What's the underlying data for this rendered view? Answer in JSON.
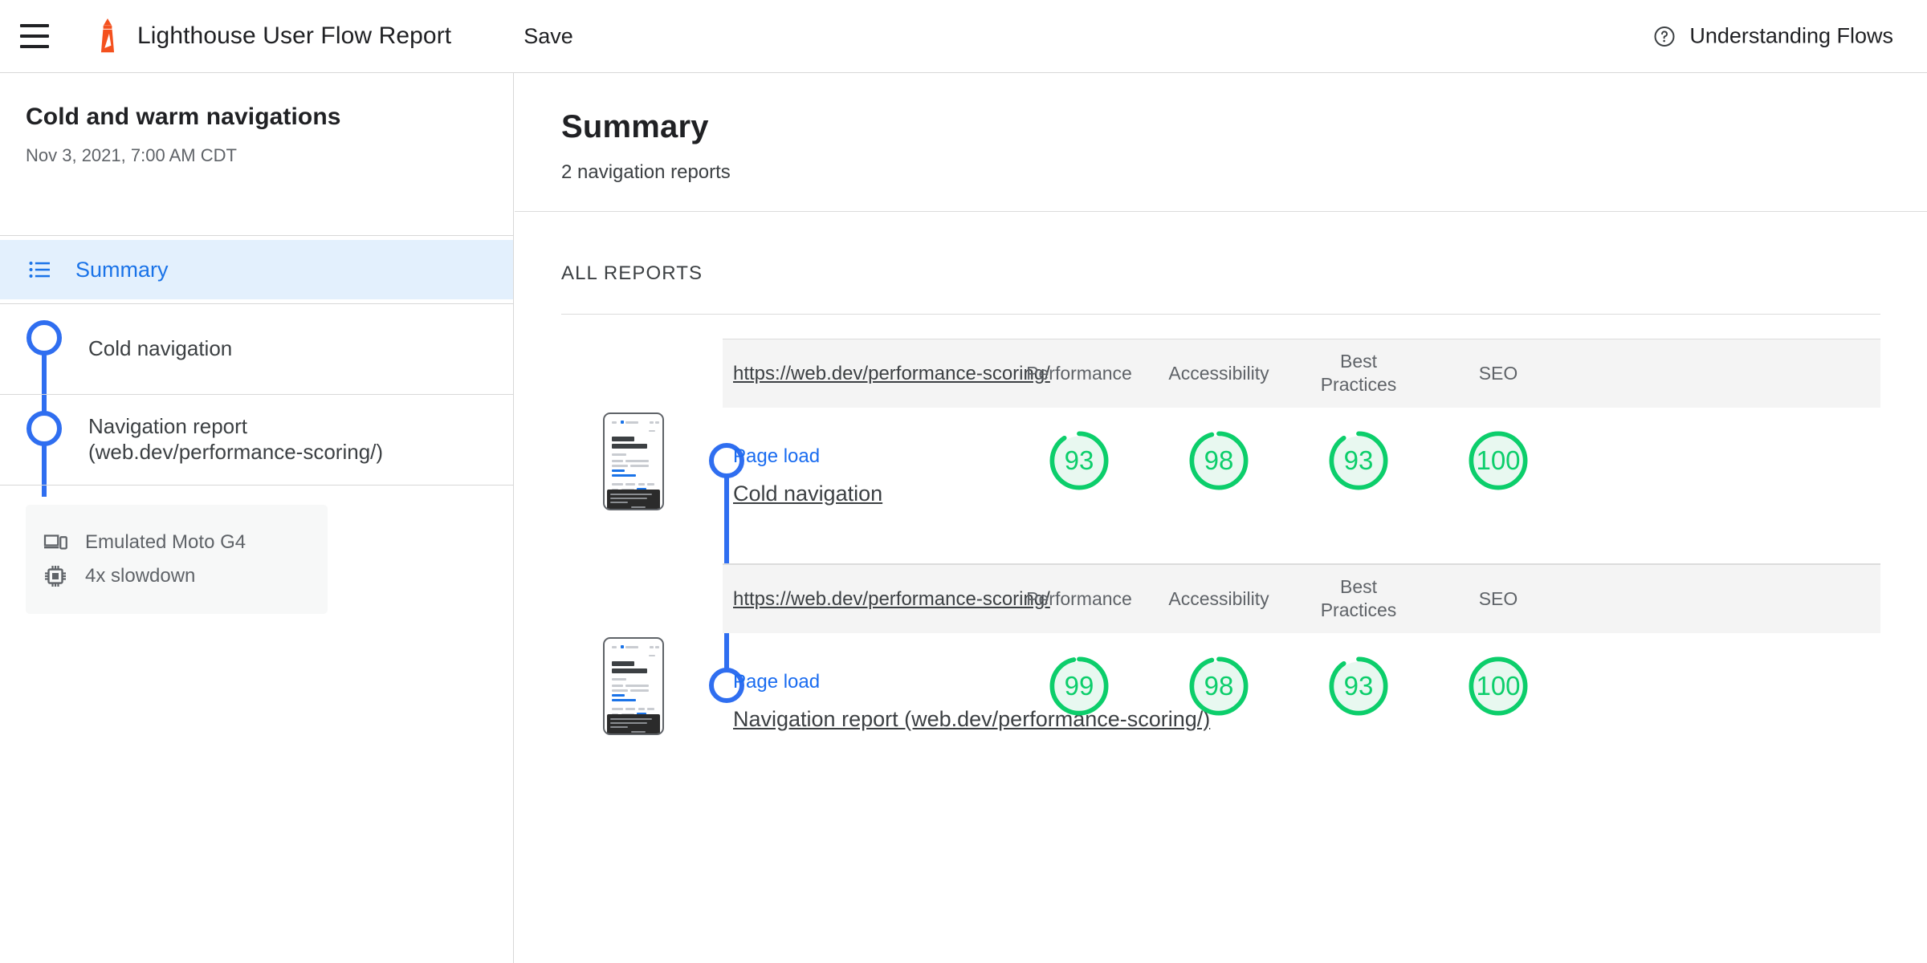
{
  "header": {
    "menu_icon": "hamburger-menu-icon",
    "logo_icon": "lighthouse-logo-icon",
    "title": "Lighthouse User Flow Report",
    "save_label": "Save",
    "help_icon": "help-circle-icon",
    "help_label": "Understanding Flows"
  },
  "sidebar": {
    "flow_title": "Cold and warm navigations",
    "flow_date": "Nov 3, 2021, 7:00 AM CDT",
    "summary_item": {
      "icon": "list-icon",
      "label": "Summary"
    },
    "steps": [
      {
        "label": "Cold navigation"
      },
      {
        "label": "Navigation report (web.dev/performance-scoring/)"
      }
    ],
    "environment": [
      {
        "icon": "device-icon",
        "label": "Emulated Moto G4"
      },
      {
        "icon": "cpu-icon",
        "label": "4x slowdown"
      }
    ]
  },
  "main": {
    "title": "Summary",
    "subtitle": "2 navigation reports",
    "all_reports_label": "ALL REPORTS",
    "columns": [
      "Performance",
      "Accessibility",
      "Best\nPractices",
      "SEO"
    ],
    "reports": [
      {
        "url": "https://web.dev/performance-scoring/",
        "gather_mode": "Page load",
        "name": "Cold navigation",
        "scores": [
          {
            "category": "Performance",
            "value": 93
          },
          {
            "category": "Accessibility",
            "value": 98
          },
          {
            "category": "Best Practices",
            "value": 93
          },
          {
            "category": "SEO",
            "value": 100
          }
        ]
      },
      {
        "url": "https://web.dev/performance-scoring/",
        "gather_mode": "Page load",
        "name": "Navigation report (web.dev/performance-scoring/)",
        "scores": [
          {
            "category": "Performance",
            "value": 99
          },
          {
            "category": "Accessibility",
            "value": 98
          },
          {
            "category": "Best Practices",
            "value": 93
          },
          {
            "category": "SEO",
            "value": 100
          }
        ]
      }
    ]
  },
  "colors": {
    "pass_green": "#0cce6b",
    "pass_green_bg": "#e8f8f0",
    "accent_blue": "#1a73e8",
    "step_blue": "#2f6ef0",
    "logo_orange": "#f4511e",
    "selected_bg": "#e3f0fd"
  }
}
